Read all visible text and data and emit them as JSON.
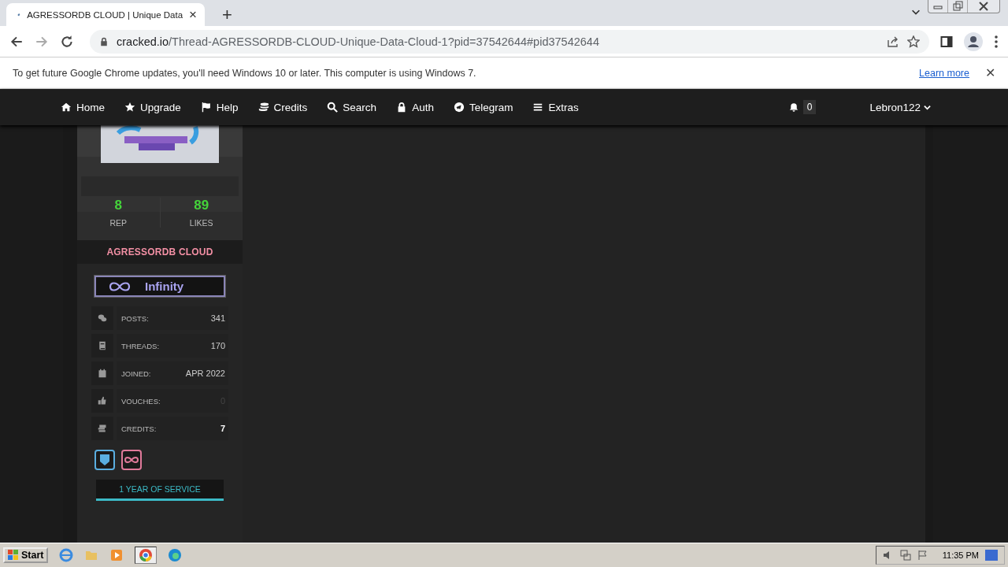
{
  "browser": {
    "tab": {
      "title": "AGRESSORDB CLOUD | Unique Data",
      "close": "×"
    },
    "new_tab": "+",
    "address": {
      "host": "cracked.io",
      "path": "/Thread-AGRESSORDB-CLOUD-Unique-Data-Cloud-1?pid=37542644#pid37542644"
    }
  },
  "infobar": {
    "message": "To get future Google Chrome updates, you'll need Windows 10 or later. This computer is using Windows 7.",
    "link": "Learn more",
    "close": "✕"
  },
  "nav": {
    "items": [
      {
        "label": "Home",
        "kind": "home"
      },
      {
        "label": "Upgrade",
        "kind": "star"
      },
      {
        "label": "Help",
        "kind": "flag"
      },
      {
        "label": "Credits",
        "kind": "coins"
      },
      {
        "label": "Search",
        "kind": "search"
      },
      {
        "label": "Auth",
        "kind": "lock"
      },
      {
        "label": "Telegram",
        "kind": "telegram"
      },
      {
        "label": "Extras",
        "kind": "menu"
      }
    ],
    "notifications": "0",
    "user": "Lebron122"
  },
  "profile": {
    "rep": "8",
    "rep_label": "REP",
    "likes": "89",
    "likes_label": "LIKES",
    "username": "AGRESSORDB CLOUD",
    "rank": "Infinity",
    "stats": [
      {
        "label": "POSTS:",
        "value": "341",
        "kind": "chat",
        "dimmed": false,
        "highlighted": false
      },
      {
        "label": "THREADS:",
        "value": "170",
        "kind": "book",
        "dimmed": false,
        "highlighted": false
      },
      {
        "label": "JOINED:",
        "value": "APR 2022",
        "kind": "calendar",
        "dimmed": false,
        "highlighted": false
      },
      {
        "label": "VOUCHES:",
        "value": "0",
        "kind": "thumb",
        "dimmed": true,
        "highlighted": false
      },
      {
        "label": "CREDITS:",
        "value": "7",
        "kind": "money",
        "dimmed": false,
        "highlighted": true
      }
    ],
    "awards": [
      {
        "kind": "shield",
        "color": "#5aaee0"
      },
      {
        "kind": "infinity",
        "color": "#e07a9a"
      }
    ],
    "service": "1 YEAR OF SERVICE"
  },
  "taskbar": {
    "start": "Start",
    "clock": "11:35 PM"
  }
}
